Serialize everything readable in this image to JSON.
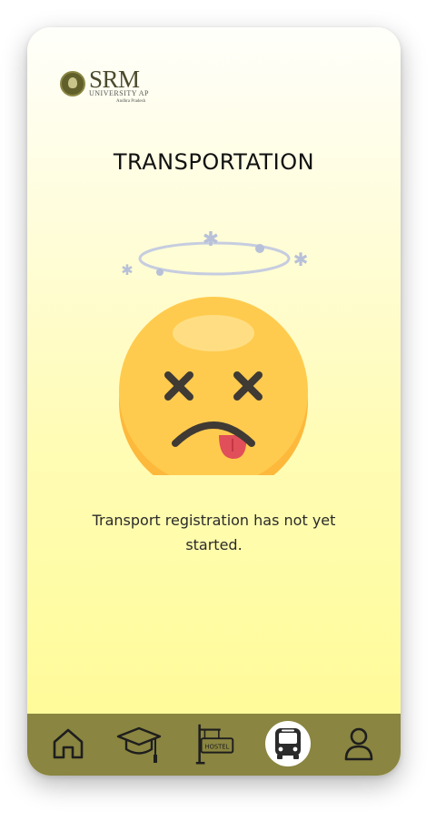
{
  "header": {
    "logo_name": "SRM",
    "logo_subtitle": "UNIVERSITY AP",
    "logo_tagline": "Andhra Pradesh"
  },
  "page": {
    "title": "TRANSPORTATION",
    "message": "Transport registration has not yet started."
  },
  "navbar": {
    "items": [
      {
        "name": "home",
        "icon": "home-icon",
        "active": false
      },
      {
        "name": "academics",
        "icon": "graduation-cap-icon",
        "active": false
      },
      {
        "name": "hostel",
        "icon": "hostel-sign-icon",
        "label": "HOSTEL",
        "active": false
      },
      {
        "name": "transport",
        "icon": "bus-icon",
        "active": true
      },
      {
        "name": "profile",
        "icon": "user-icon",
        "active": false
      }
    ],
    "bar_color": "#8a8540",
    "active_bg": "#ffffff"
  }
}
